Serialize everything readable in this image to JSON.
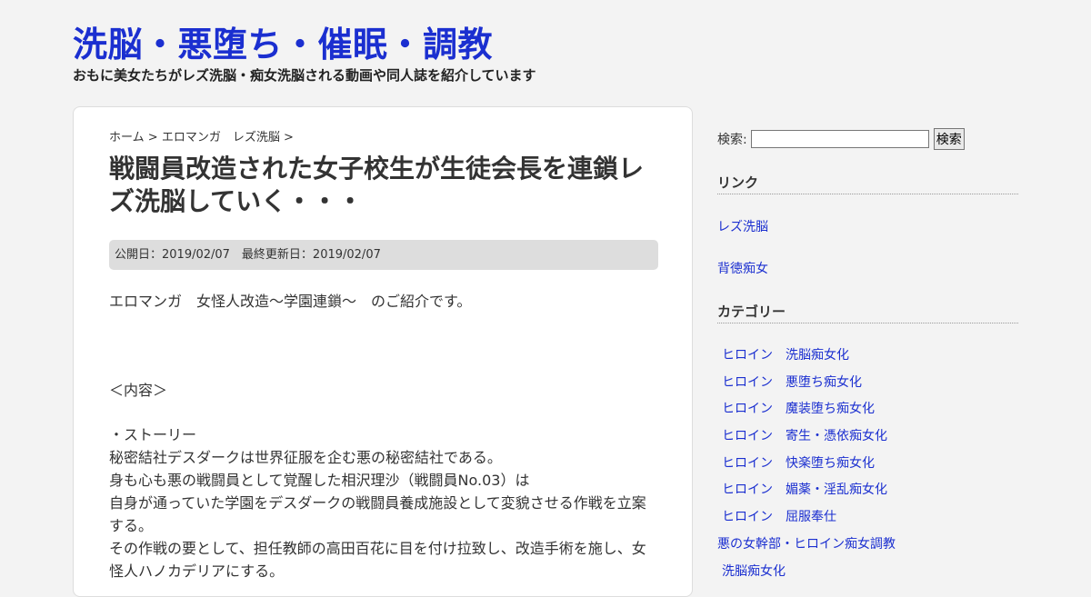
{
  "site": {
    "title": "洗脳・悪堕ち・催眠・調教",
    "description": "おもに美女たちがレズ洗脳・痴女洗脳される動画や同人誌を紹介しています"
  },
  "breadcrumb": {
    "home": "ホーム",
    "sep1": ">",
    "category": "エロマンガ　レズ洗脳",
    "sep2": ">"
  },
  "post": {
    "title": "戦闘員改造された女子校生が生徒会長を連鎖レズ洗脳していく・・・",
    "dates": "公開日：2019/02/07　最終更新日：2019/02/07",
    "paragraphs": [
      "エロマンガ　女怪人改造～学園連鎖～　のご紹介です。",
      "＜内容＞",
      "・ストーリー",
      "秘密結社デスダークは世界征服を企む悪の秘密結社である。",
      "身も心も悪の戦闘員として覚醒した相沢理沙（戦闘員No.03）は",
      "自身が通っていた学園をデスダークの戦闘員養成施設として変貌させる作戦を立案する。",
      "その作戦の要として、担任教師の高田百花に目を付け拉致し、改造手術を施し、女怪人ハノカデリアにする。"
    ]
  },
  "sidebar": {
    "search_label": "検索:",
    "search_value": "",
    "search_button": "検索",
    "links_title": "リンク",
    "links": [
      "レズ洗脳",
      "背徳痴女"
    ],
    "categories_title": "カテゴリー",
    "categories": [
      "ヒロイン　洗脳痴女化",
      "ヒロイン　悪堕ち痴女化",
      "ヒロイン　魔装堕ち痴女化",
      "ヒロイン　寄生・憑依痴女化",
      "ヒロイン　快楽堕ち痴女化",
      "ヒロイン　媚薬・淫乱痴女化",
      "ヒロイン　屈服奉仕",
      "悪の女幹部・ヒロイン痴女調教",
      "洗脳痴女化"
    ]
  }
}
